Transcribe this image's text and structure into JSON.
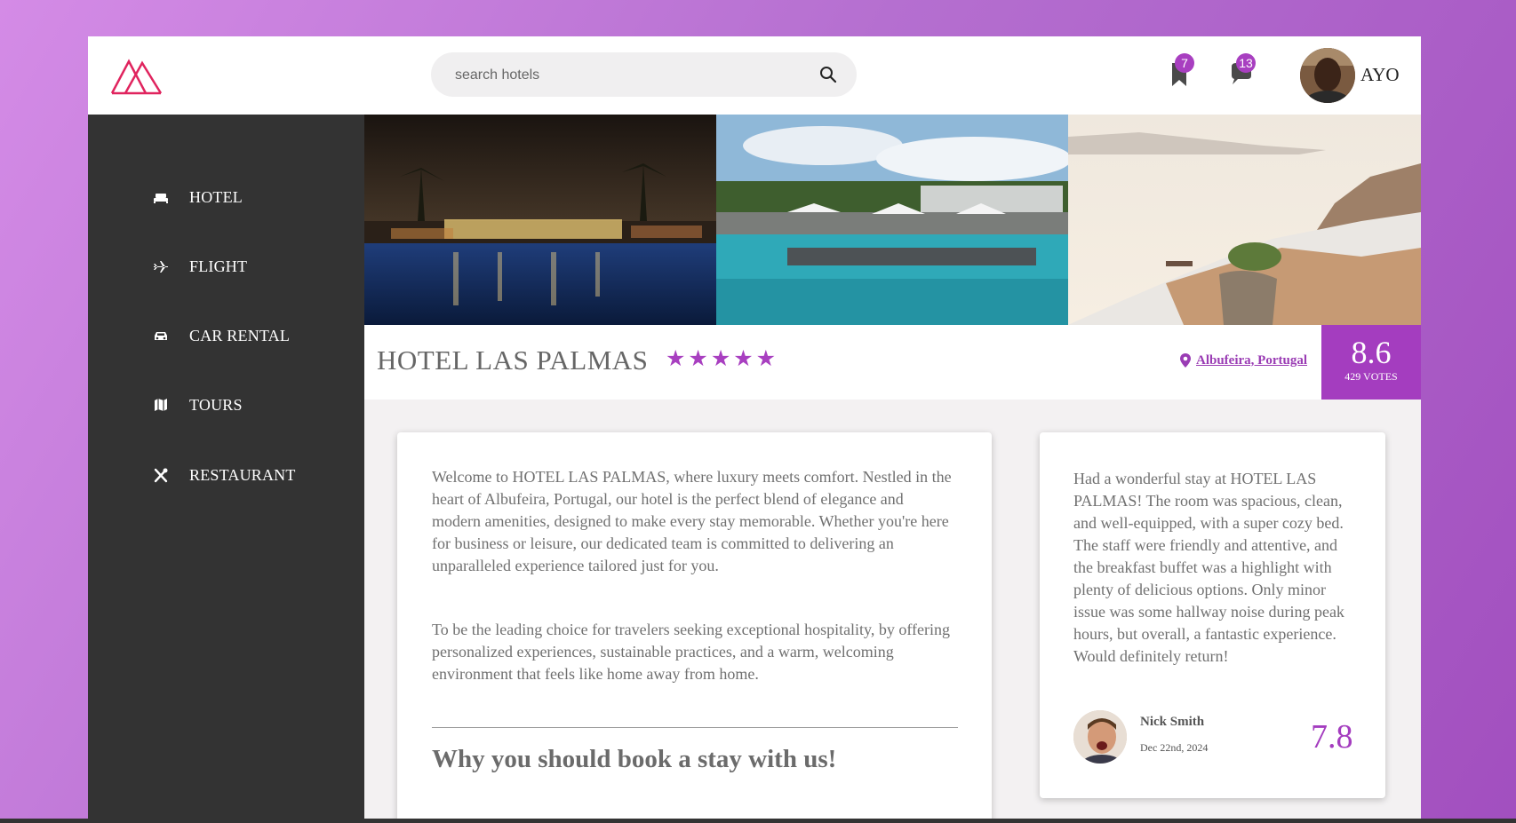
{
  "header": {
    "search_placeholder": "search hotels",
    "bookmarks_count": "7",
    "messages_count": "13",
    "username": "AYO"
  },
  "sidebar": {
    "items": [
      {
        "label": "HOTEL",
        "icon": "bed-icon"
      },
      {
        "label": "FLIGHT",
        "icon": "airplane-icon"
      },
      {
        "label": "CAR RENTAL",
        "icon": "car-icon"
      },
      {
        "label": "TOURS",
        "icon": "map-icon"
      },
      {
        "label": "RESTAURANT",
        "icon": "utensils-icon"
      }
    ]
  },
  "hotel": {
    "name": "HOTEL LAS PALMAS",
    "stars": "★★★★★",
    "location": "Albufeira, Portugal",
    "score": "8.6",
    "votes": "429 VOTES"
  },
  "description": {
    "intro": "Welcome to HOTEL LAS PALMAS, where luxury meets comfort. Nestled in the heart of Albufeira, Portugal, our hotel is the perfect blend of elegance and modern amenities, designed to make every stay memorable. Whether you're here for business or leisure, our dedicated team is committed to delivering an unparalleled experience tailored just for you.",
    "mission": "To be the leading choice for travelers seeking exceptional hospitality, by offering personalized experiences, sustainable practices, and a warm, welcoming environment that feels like home away from home.",
    "why_heading": "Why you should book a stay with us!"
  },
  "review": {
    "text": "Had a wonderful stay at HOTEL LAS PALMAS! The room was spacious, clean, and well-equipped, with a super cozy bed. The staff were friendly and attentive, and the breakfast buffet was a highlight with plenty of delicious options. Only minor issue was some hallway noise during peak hours, but overall, a fantastic experience. Would definitely return!",
    "reviewer": "Nick Smith",
    "date": "Dec 22nd, 2024",
    "score": "7.8"
  },
  "colors": {
    "accent": "#a43dbf",
    "sidebar": "#333333",
    "logo": "#e0245e"
  }
}
